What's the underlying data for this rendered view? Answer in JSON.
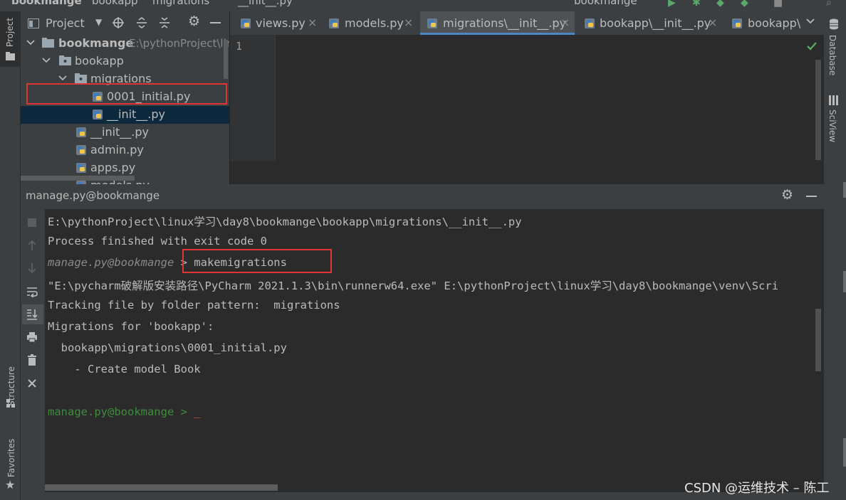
{
  "topbar": {
    "crumbs": [
      "bookmange",
      "bookapp",
      "migrations",
      "__init__.py"
    ],
    "run_config": "bookmange"
  },
  "left_stripe": {
    "project_tab": "Project",
    "structure_tab": "Structure",
    "favorites_tab": "Favorites"
  },
  "right_stripe": {
    "database_tab": "Database",
    "sciview_tab": "SciView"
  },
  "project_panel": {
    "title": "Project",
    "root": {
      "name": "bookmange",
      "path": "E:\\pythonProject\\lir"
    },
    "items": [
      {
        "label": "bookapp",
        "type": "folder"
      },
      {
        "label": "migrations",
        "type": "folder"
      },
      {
        "label": "0001_initial.py",
        "type": "python-file"
      },
      {
        "label": "__init__.py",
        "type": "python-file"
      },
      {
        "label": "__init__.py",
        "type": "python-file"
      },
      {
        "label": "admin.py",
        "type": "python-file"
      },
      {
        "label": "apps.py",
        "type": "python-file"
      },
      {
        "label": "models.py",
        "type": "python-file"
      }
    ]
  },
  "editor_tabs": {
    "tabs": [
      {
        "label": "views.py",
        "close": "×"
      },
      {
        "label": "models.py",
        "close": "×"
      },
      {
        "label": "migrations\\__init__.py",
        "close": "×",
        "active": true
      },
      {
        "label": "bookapp\\__init__.py",
        "close": "×"
      },
      {
        "label": "bookapp\\"
      }
    ],
    "overflow_icon": "chevron-down-icon"
  },
  "editor": {
    "line_number": "1",
    "status_icon": "check-icon"
  },
  "run_panel": {
    "title": "manage.py@bookmange",
    "toolbar_icons": [
      "stop-icon",
      "up-arrow-icon",
      "down-arrow-icon",
      "soft-wrap-icon",
      "scroll-to-end-icon",
      "print-icon",
      "trash-icon",
      "close-icon"
    ]
  },
  "console": {
    "line1": "E:\\pythonProject\\linux学习\\day8\\bookmange\\bookapp\\migrations\\__init__.py",
    "line2": "Process finished with exit code 0",
    "line3_prompt": "manage.py@bookmange",
    "line3_cmd": " > makemigrations",
    "line4": "\"E:\\pycharm破解版安装路径\\PyCharm 2021.1.3\\bin\\runnerw64.exe\" E:\\pythonProject\\linux学习\\day8\\bookmange\\venv\\Scri",
    "line5": "Tracking file by folder pattern:  migrations",
    "line6": "Migrations for 'bookapp':",
    "line7": "  bookapp\\migrations\\0001_initial.py",
    "line8": "    - Create model Book",
    "line9_prompt": "manage.py@bookmange > ",
    "cursor": "_"
  },
  "watermark": "CSDN @运维技术 – 陈工",
  "colors": {
    "panel_bg": "#3c3f41",
    "editor_bg": "#2b2b2b",
    "selection": "#0d293e",
    "accent_blue": "#4a88c7",
    "annotation_red": "#e03535",
    "prompt_green": "#3d8c3d",
    "check_green": "#59a869"
  }
}
